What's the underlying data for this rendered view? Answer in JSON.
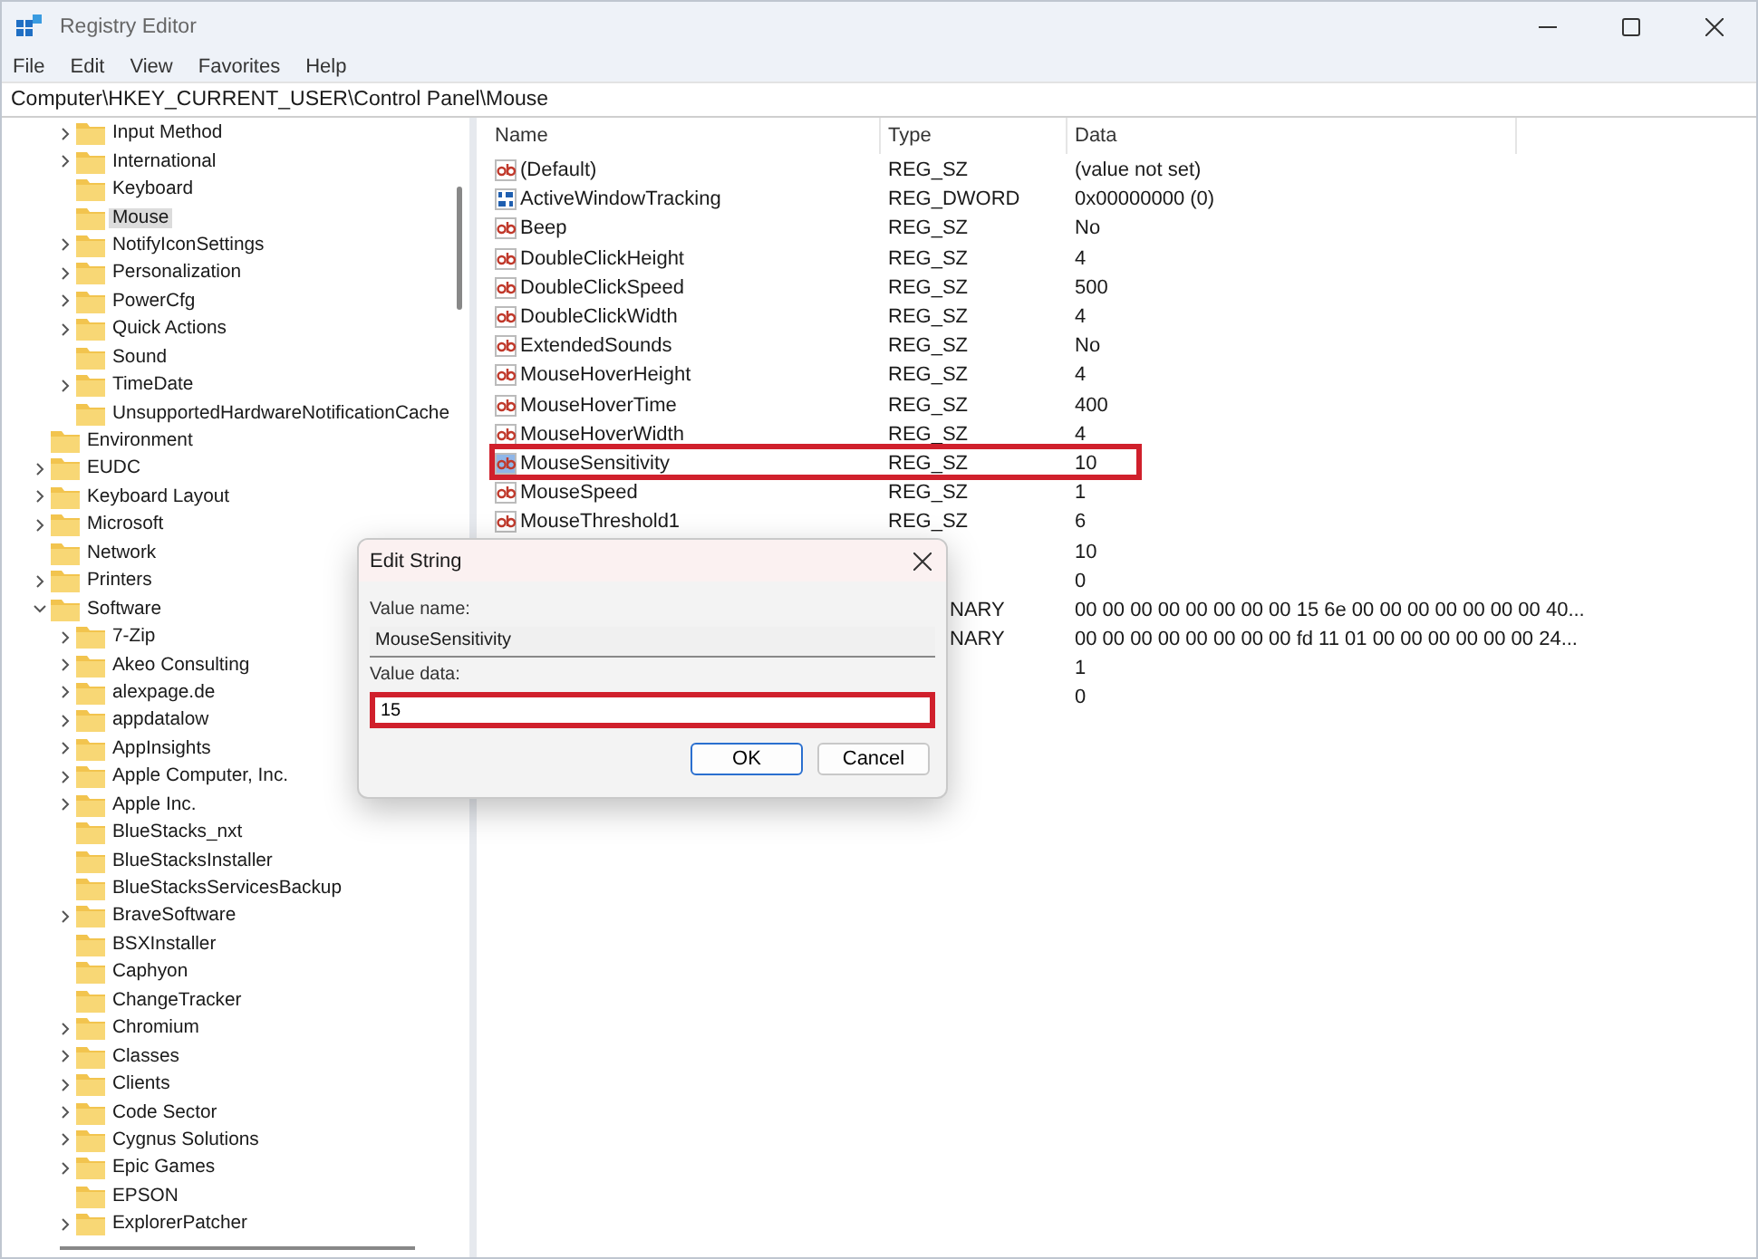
{
  "window": {
    "title": "Registry Editor"
  },
  "menu": [
    "File",
    "Edit",
    "View",
    "Favorites",
    "Help"
  ],
  "address": "Computer\\HKEY_CURRENT_USER\\Control Panel\\Mouse",
  "tree": [
    {
      "children": [
        {
          "label": "Input Method",
          "expanded": false,
          "selected": false
        },
        {
          "label": "International",
          "expanded": false,
          "selected": false
        },
        {
          "label": "Keyboard",
          "selected": false
        },
        {
          "label": "Mouse",
          "selected": true
        },
        {
          "label": "NotifyIconSettings",
          "expanded": false,
          "selected": false
        },
        {
          "label": "Personalization",
          "expanded": false,
          "selected": false
        },
        {
          "label": "PowerCfg",
          "expanded": false,
          "selected": false
        },
        {
          "label": "Quick Actions",
          "expanded": false,
          "selected": false
        },
        {
          "label": "Sound",
          "selected": false
        },
        {
          "label": "TimeDate",
          "expanded": false,
          "selected": false
        },
        {
          "label": "UnsupportedHardwareNotificationCache",
          "selected": false
        }
      ]
    },
    {
      "label": "Environment",
      "selected": false
    },
    {
      "label": "EUDC",
      "expanded": false,
      "selected": false
    },
    {
      "label": "Keyboard Layout",
      "expanded": false,
      "selected": false
    },
    {
      "label": "Microsoft",
      "expanded": false,
      "selected": false
    },
    {
      "label": "Network",
      "selected": false
    },
    {
      "label": "Printers",
      "expanded": false,
      "selected": false
    },
    {
      "label": "Software",
      "expanded": true,
      "selected": false,
      "children": [
        {
          "label": "7-Zip",
          "expanded": false,
          "selected": false
        },
        {
          "label": "Akeo Consulting",
          "expanded": false,
          "selected": false
        },
        {
          "label": "alexpage.de",
          "expanded": false,
          "selected": false
        },
        {
          "label": "appdatalow",
          "expanded": false,
          "selected": false
        },
        {
          "label": "AppInsights",
          "expanded": false,
          "selected": false
        },
        {
          "label": "Apple Computer, Inc.",
          "expanded": false,
          "selected": false
        },
        {
          "label": "Apple Inc.",
          "expanded": false,
          "selected": false
        },
        {
          "label": "BlueStacks_nxt",
          "selected": false
        },
        {
          "label": "BlueStacksInstaller",
          "selected": false
        },
        {
          "label": "BlueStacksServicesBackup",
          "selected": false
        },
        {
          "label": "BraveSoftware",
          "expanded": false,
          "selected": false
        },
        {
          "label": "BSXInstaller",
          "selected": false
        },
        {
          "label": "Caphyon",
          "selected": false
        },
        {
          "label": "ChangeTracker",
          "selected": false
        },
        {
          "label": "Chromium",
          "expanded": false,
          "selected": false
        },
        {
          "label": "Classes",
          "expanded": false,
          "selected": false
        },
        {
          "label": "Clients",
          "expanded": false,
          "selected": false
        },
        {
          "label": "Code Sector",
          "expanded": false,
          "selected": false
        },
        {
          "label": "Cygnus Solutions",
          "expanded": false,
          "selected": false
        },
        {
          "label": "Epic Games",
          "expanded": false,
          "selected": false
        },
        {
          "label": "EPSON",
          "selected": false
        },
        {
          "label": "ExplorerPatcher",
          "expanded": false,
          "selected": false
        }
      ]
    }
  ],
  "values": {
    "columns": [
      "Name",
      "Type",
      "Data"
    ],
    "rows": [
      {
        "kind": "string",
        "name": "(Default)",
        "type": "REG_SZ",
        "data": "(value not set)",
        "selected": false,
        "highlighted": false
      },
      {
        "kind": "binary",
        "name": "ActiveWindowTracking",
        "type": "REG_DWORD",
        "data": "0x00000000 (0)",
        "selected": false,
        "highlighted": false
      },
      {
        "kind": "string",
        "name": "Beep",
        "type": "REG_SZ",
        "data": "No",
        "selected": false,
        "highlighted": false
      },
      {
        "kind": "string",
        "name": "DoubleClickHeight",
        "type": "REG_SZ",
        "data": "4",
        "selected": false,
        "highlighted": false
      },
      {
        "kind": "string",
        "name": "DoubleClickSpeed",
        "type": "REG_SZ",
        "data": "500",
        "selected": false,
        "highlighted": false
      },
      {
        "kind": "string",
        "name": "DoubleClickWidth",
        "type": "REG_SZ",
        "data": "4",
        "selected": false,
        "highlighted": false
      },
      {
        "kind": "string",
        "name": "ExtendedSounds",
        "type": "REG_SZ",
        "data": "No",
        "selected": false,
        "highlighted": false
      },
      {
        "kind": "string",
        "name": "MouseHoverHeight",
        "type": "REG_SZ",
        "data": "4",
        "selected": false,
        "highlighted": false
      },
      {
        "kind": "string",
        "name": "MouseHoverTime",
        "type": "REG_SZ",
        "data": "400",
        "selected": false,
        "highlighted": false
      },
      {
        "kind": "string",
        "name": "MouseHoverWidth",
        "type": "REG_SZ",
        "data": "4",
        "selected": false,
        "highlighted": false
      },
      {
        "kind": "string",
        "name": "MouseSensitivity",
        "type": "REG_SZ",
        "data": "10",
        "selected": true,
        "highlighted": true
      },
      {
        "kind": "string",
        "name": "MouseSpeed",
        "type": "REG_SZ",
        "data": "1",
        "selected": false,
        "highlighted": false
      },
      {
        "kind": "string",
        "name": "MouseThreshold1",
        "type": "REG_SZ",
        "data": "6",
        "selected": false,
        "highlighted": false
      },
      {
        "kind": "covered",
        "data": "10"
      },
      {
        "kind": "covered",
        "data": "0"
      },
      {
        "kind": "covered",
        "type": "NARY",
        "data": "00 00 00 00 00 00 00 00 15 6e 00 00 00 00 00 00 00 40..."
      },
      {
        "kind": "covered",
        "type": "NARY",
        "data": "00 00 00 00 00 00 00 00 fd 11 01 00 00 00 00 00 00 24..."
      },
      {
        "kind": "covered",
        "data": "1"
      },
      {
        "kind": "covered",
        "data": "0"
      }
    ]
  },
  "dialog": {
    "title": "Edit String",
    "name_label": "Value name:",
    "name_value": "MouseSensitivity",
    "data_label": "Value data:",
    "data_value": "15",
    "data_highlighted": true,
    "buttons": [
      {
        "label": "OK",
        "default": true
      },
      {
        "label": "Cancel",
        "default": false
      }
    ]
  }
}
